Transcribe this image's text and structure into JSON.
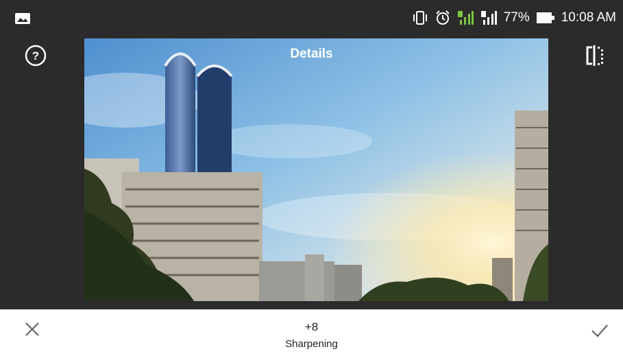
{
  "status_bar": {
    "battery_percent": "77%",
    "time": "10:08 AM",
    "icons": [
      "gallery-icon",
      "vibrate-icon",
      "alarm-icon",
      "signal-sim1-icon",
      "signal-sim2-icon",
      "battery-icon"
    ],
    "sim1_color": "#7cc63f"
  },
  "toolbar": {
    "title": "Details",
    "help_icon": "help-circle-icon",
    "compare_icon": "compare-icon"
  },
  "bottom_bar": {
    "value": "+8",
    "label": "Sharpening",
    "cancel_icon": "close-icon",
    "apply_icon": "check-icon"
  },
  "colors": {
    "background": "#2b2b2b",
    "bottom_bar": "#ffffff",
    "accent": "#1e88e5"
  }
}
